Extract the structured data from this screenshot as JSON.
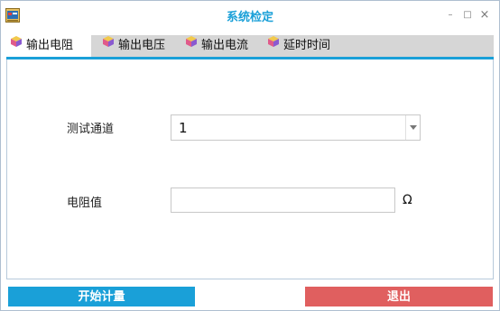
{
  "window": {
    "title": "系统检定",
    "controls": {
      "minimize": "–",
      "maximize": "□",
      "close": "×"
    }
  },
  "tabs": [
    {
      "label": "输出电阻",
      "active": true
    },
    {
      "label": "输出电压",
      "active": false
    },
    {
      "label": "输出电流",
      "active": false
    },
    {
      "label": "延时时间",
      "active": false
    }
  ],
  "form": {
    "channel_label": "测试通道",
    "channel_value": "1",
    "resistance_label": "电阻值",
    "resistance_value": "",
    "resistance_unit": "Ω"
  },
  "buttons": {
    "start_label": "开始计量",
    "exit_label": "退出"
  },
  "colors": {
    "accent": "#1aa0d8",
    "danger": "#e05f5f",
    "tab_strip": "#d6d6d6"
  }
}
